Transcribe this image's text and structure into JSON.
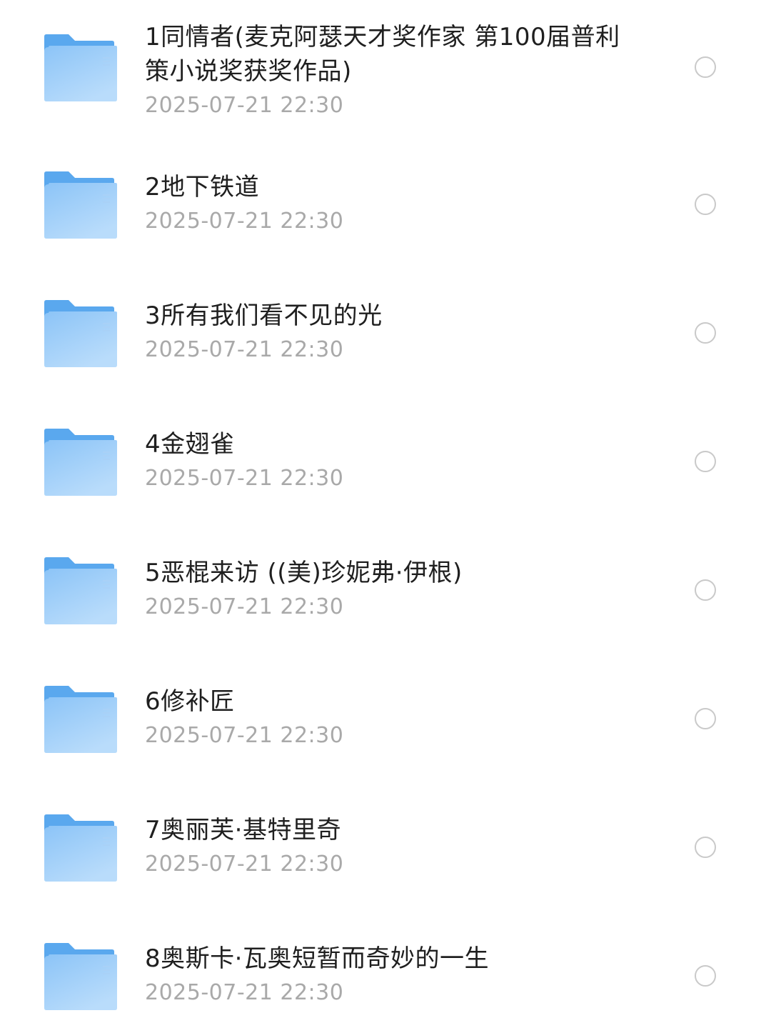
{
  "folders": [
    {
      "name": "1同情者(麦克阿瑟天才奖作家 第100届普利策小说奖获奖作品)",
      "date": "2025-07-21 22:30"
    },
    {
      "name": "2地下铁道",
      "date": "2025-07-21 22:30"
    },
    {
      "name": "3所有我们看不见的光",
      "date": "2025-07-21 22:30"
    },
    {
      "name": "4金翅雀",
      "date": "2025-07-21 22:30"
    },
    {
      "name": "5恶棍来访 ((美)珍妮弗·伊根)",
      "date": "2025-07-21 22:30"
    },
    {
      "name": "6修补匠",
      "date": "2025-07-21 22:30"
    },
    {
      "name": "7奥丽芙·基特里奇",
      "date": "2025-07-21 22:30"
    },
    {
      "name": "8奥斯卡·瓦奥短暂而奇妙的一生",
      "date": "2025-07-21 22:30"
    }
  ],
  "icons": {
    "folder": "folder-icon",
    "select": "radio-circle-icon"
  },
  "colors": {
    "folder_back": "#5aa8ee",
    "folder_front_top": "#8cc4f7",
    "folder_front_bottom": "#b9dcfb",
    "title_text": "#1f1f1f",
    "date_text": "#a9a9a9",
    "radio_border": "#c9c9c9"
  }
}
